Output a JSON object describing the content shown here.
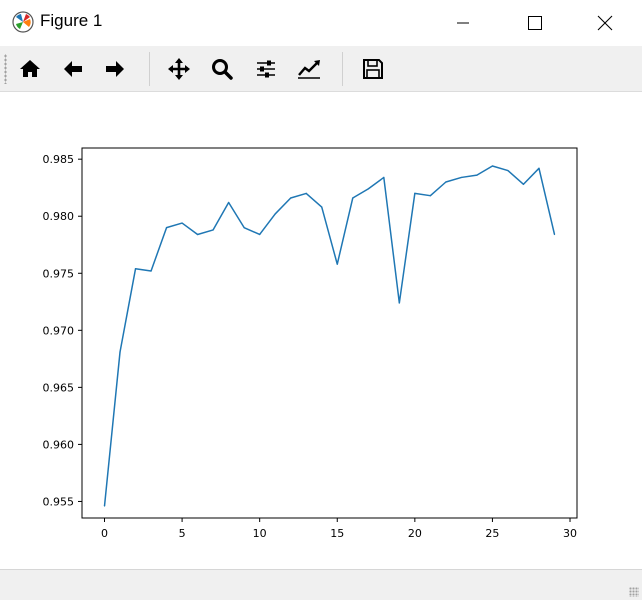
{
  "window": {
    "title": "Figure 1",
    "icon": "matplotlib-icon",
    "controls": [
      "minimize-icon",
      "maximize-icon",
      "close-icon"
    ]
  },
  "toolbar": {
    "buttons": [
      {
        "name": "home",
        "icon": "home-icon"
      },
      {
        "name": "back",
        "icon": "arrow-left-icon"
      },
      {
        "name": "forward",
        "icon": "arrow-right-icon"
      },
      {
        "name": "pan",
        "icon": "move-icon"
      },
      {
        "name": "zoom",
        "icon": "magnifier-icon"
      },
      {
        "name": "subplots",
        "icon": "sliders-icon"
      },
      {
        "name": "edit-axes",
        "icon": "line-chart-icon"
      },
      {
        "name": "save",
        "icon": "floppy-disk-icon"
      }
    ]
  },
  "chart_data": {
    "type": "line",
    "title": "",
    "xlabel": "",
    "ylabel": "",
    "xlim": [
      -1.45,
      30.45
    ],
    "ylim": [
      0.95355,
      0.98598
    ],
    "xticks": [
      0,
      5,
      10,
      15,
      20,
      25,
      30
    ],
    "xtick_labels": [
      "0",
      "5",
      "10",
      "15",
      "20",
      "25",
      "30"
    ],
    "yticks": [
      0.955,
      0.96,
      0.965,
      0.97,
      0.975,
      0.98,
      0.985
    ],
    "ytick_labels": [
      "0.955",
      "0.960",
      "0.965",
      "0.970",
      "0.975",
      "0.980",
      "0.985"
    ],
    "grid": false,
    "line_color": "#1f77b4",
    "series": [
      {
        "x": [
          0,
          1,
          2,
          3,
          4,
          5,
          6,
          7,
          8,
          9,
          10,
          11,
          12,
          13,
          14,
          15,
          16,
          17,
          18,
          19,
          20,
          21,
          22,
          23,
          24,
          25,
          26,
          27,
          28,
          29
        ],
        "values": [
          0.9546,
          0.9681,
          0.9754,
          0.9752,
          0.979,
          0.9794,
          0.9784,
          0.9788,
          0.9812,
          0.979,
          0.9784,
          0.9802,
          0.9816,
          0.982,
          0.9808,
          0.9758,
          0.9816,
          0.9824,
          0.9834,
          0.9724,
          0.982,
          0.9818,
          0.983,
          0.9834,
          0.9836,
          0.9844,
          0.984,
          0.9828,
          0.9842,
          0.9784
        ]
      }
    ]
  }
}
